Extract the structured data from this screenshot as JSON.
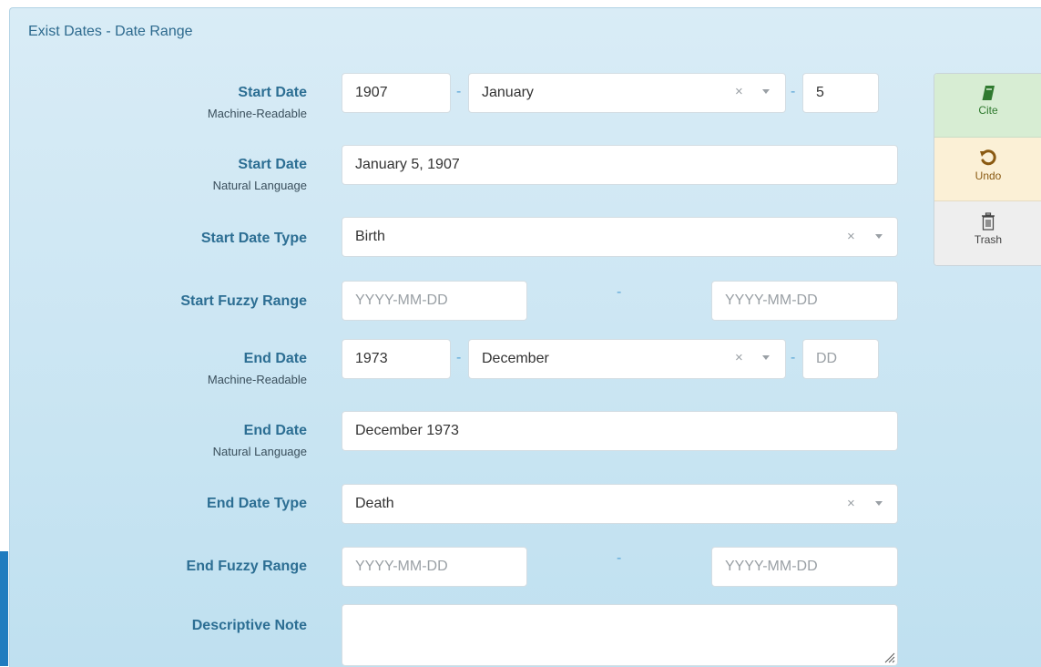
{
  "panel": {
    "title": "Exist Dates - Date Range"
  },
  "start_date": {
    "label": "Start Date",
    "sublabel": "Machine-Readable",
    "year": "1907",
    "month": "January",
    "day": "5",
    "separator": "-"
  },
  "start_date_natural": {
    "label": "Start Date",
    "sublabel": "Natural Language",
    "value": "January 5, 1907"
  },
  "start_date_type": {
    "label": "Start Date Type",
    "value": "Birth"
  },
  "start_fuzzy_range": {
    "label": "Start Fuzzy Range",
    "from_placeholder": "YYYY-MM-DD",
    "to_placeholder": "YYYY-MM-DD",
    "separator": "-"
  },
  "end_date": {
    "label": "End Date",
    "sublabel": "Machine-Readable",
    "year": "1973",
    "month": "December",
    "day_placeholder": "DD",
    "separator": "-"
  },
  "end_date_natural": {
    "label": "End Date",
    "sublabel": "Natural Language",
    "value": "December 1973"
  },
  "end_date_type": {
    "label": "End Date Type",
    "value": "Death"
  },
  "end_fuzzy_range": {
    "label": "End Fuzzy Range",
    "from_placeholder": "YYYY-MM-DD",
    "to_placeholder": "YYYY-MM-DD",
    "separator": "-"
  },
  "descriptive_note": {
    "label": "Descriptive Note",
    "value": ""
  },
  "select_clear_glyph": "×",
  "sidebar": {
    "cite": {
      "label": "Cite",
      "icon": "book-icon",
      "color": "#2f7a2f"
    },
    "undo": {
      "label": "Undo",
      "icon": "undo-icon",
      "color": "#8a5a12"
    },
    "trash": {
      "label": "Trash",
      "icon": "trash-icon",
      "color": "#444444"
    }
  }
}
